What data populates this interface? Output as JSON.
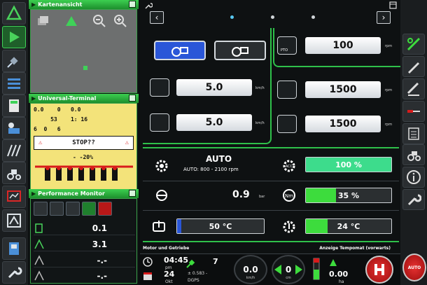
{
  "panels": {
    "map_title": "Kartenansicht",
    "ut_title": "Universal-Terminal",
    "pm_title": "Performance Monitor"
  },
  "universal_terminal": {
    "row1": "0.0    0   0.0",
    "row2": "     53    1: 16",
    "row3": "6  0   6",
    "stop_text": "STOP??",
    "percent": "- -20%"
  },
  "performance_monitor": {
    "rows": [
      {
        "value": "0.1"
      },
      {
        "value": "3.1"
      },
      {
        "value": "-.-"
      },
      {
        "value": "-.-"
      }
    ]
  },
  "main": {
    "pto_label": "PTO",
    "pto_value": "100",
    "pto_unit": "rpm",
    "speed1_value": "5.0",
    "speed1_unit": "km/h",
    "speed2_value": "5.0",
    "speed2_unit": "km/h",
    "rpm1_value": "1500",
    "rpm1_unit": "rpm",
    "rpm2_value": "1500",
    "rpm2_unit": "rpm",
    "mode_title": "AUTO",
    "mode_range": "AUTO: 800 - 2100 rpm",
    "acc_value": "100 %",
    "acc_percent": 100,
    "pressure_value": "0.9",
    "pressure_unit": "bar",
    "torque_value": "35 %",
    "torque_percent": 35,
    "temp1_value": "50 °C",
    "temp1_level": 0.05,
    "temp2_value": "24 °C",
    "temp2_level": 0.25,
    "status_left": "Motor und Getriebe",
    "status_right": "Anzeige Tempomat (vorwarts)"
  },
  "bottom": {
    "time": "04:45",
    "time_unit": "pm",
    "date_day": "24",
    "date_month": "Okt",
    "satellites": "7",
    "gps_value": "± 0.583 -",
    "gps_mode": "DGPS",
    "gauge1_value": "0.0",
    "gauge1_unit": "km/h",
    "gauge2_value": "0",
    "gauge2_unit": "cm",
    "hitch_value": "0.00",
    "hitch_unit": "ha",
    "red_button_label": "AUTO"
  },
  "colors": {
    "accent_green": "#2fc04a",
    "fill_green": "#3ddc3d",
    "fill_blue": "#2a56d8",
    "alert_red": "#d81b1b",
    "ut_yellow": "#f3e37a"
  }
}
